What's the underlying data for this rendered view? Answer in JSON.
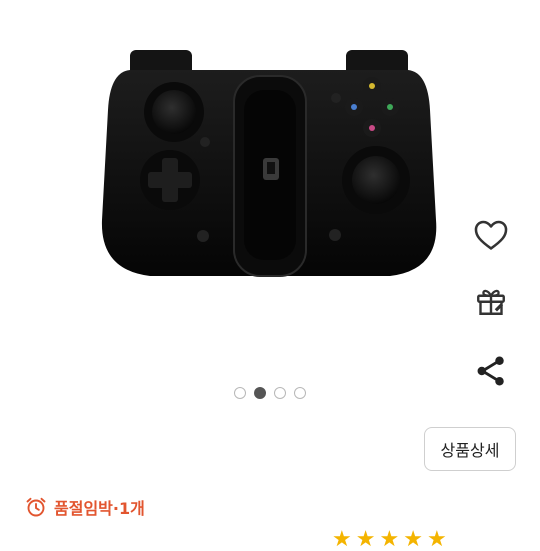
{
  "gallery": {
    "image_alt_icon": "gamepad-controller",
    "slide_count": 4,
    "active_slide": 2
  },
  "side_actions": {
    "wishlist_icon": "heart-outline-icon",
    "gift_icon": "gift-box-icon",
    "share_icon": "share-icon"
  },
  "detail_button": {
    "label": "상품상세"
  },
  "stock": {
    "icon": "alarm-clock-icon",
    "text": "품절임박·1개",
    "color": "#e2552f"
  },
  "rating": {
    "star_color": "#f4b400"
  }
}
